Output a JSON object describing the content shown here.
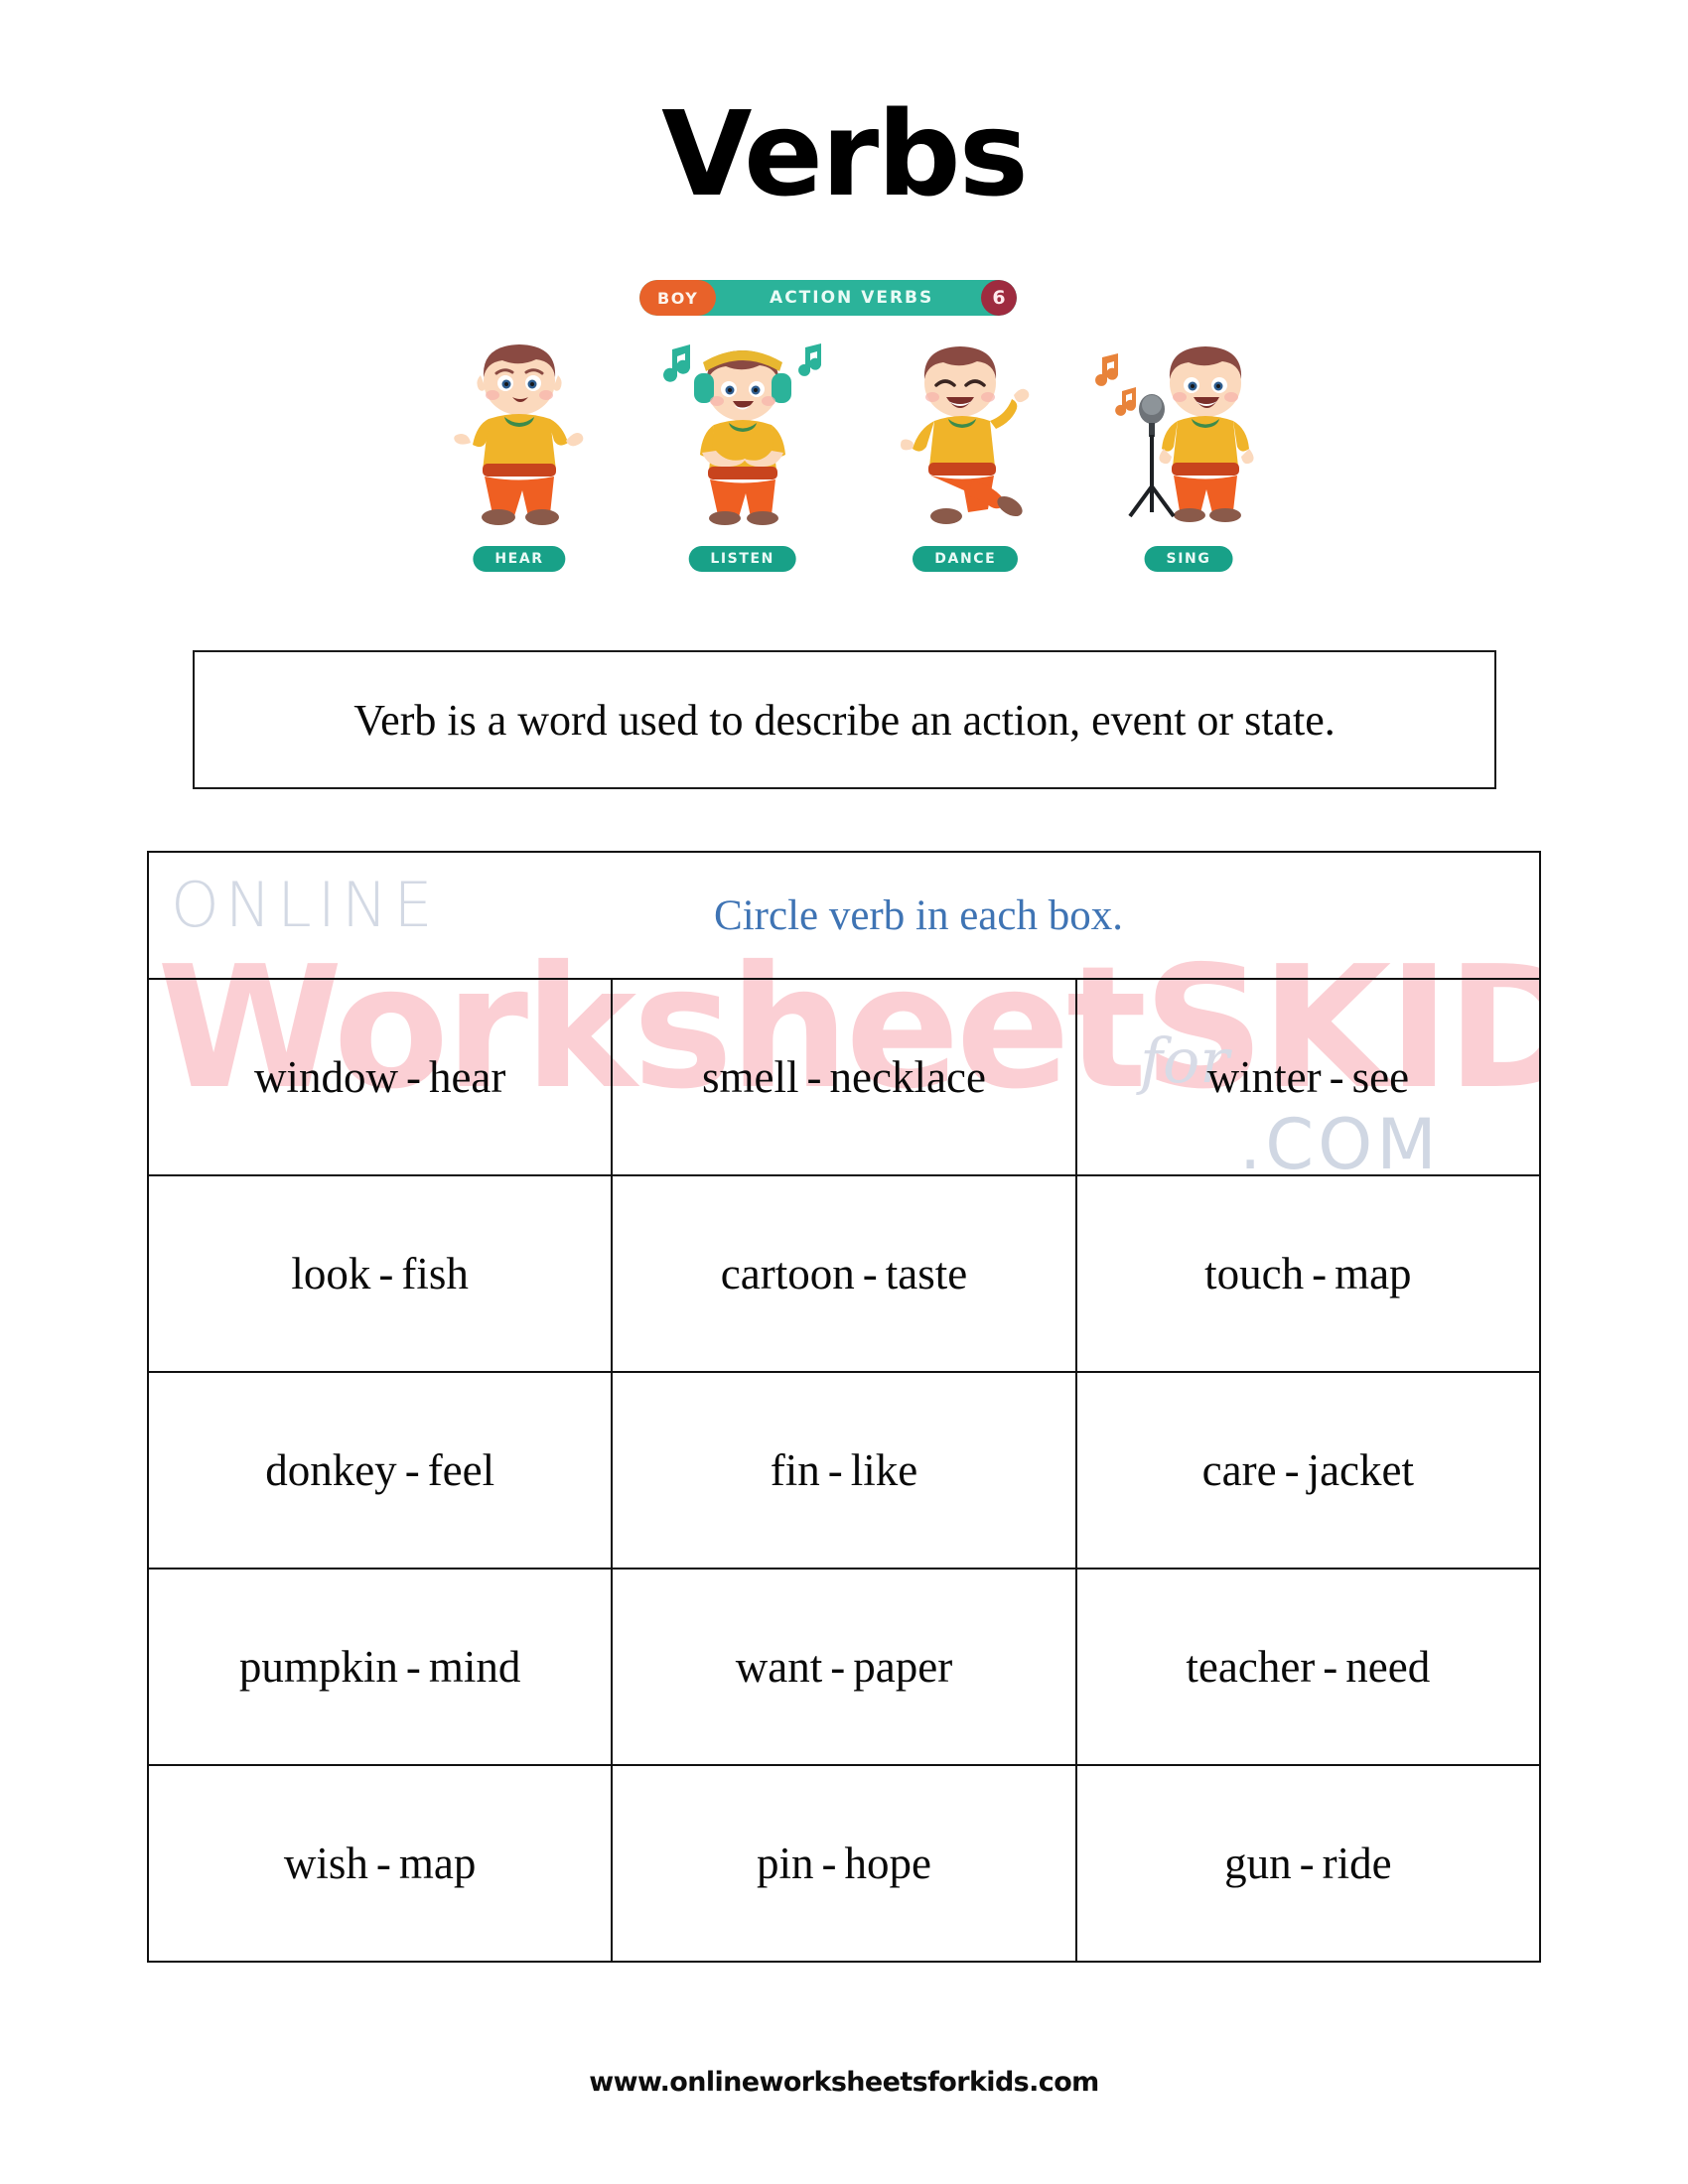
{
  "page": {
    "title": "Verbs",
    "footer_url": "www.onlineworksheetsforkids.com"
  },
  "illustration": {
    "banner": {
      "tag": "BOY",
      "label": "ACTION VERBS",
      "number": "6"
    },
    "figures": [
      {
        "label": "HEAR",
        "pose": "boy-hand-to-ear"
      },
      {
        "label": "LISTEN",
        "pose": "boy-with-headphones"
      },
      {
        "label": "DANCE",
        "pose": "boy-dancing"
      },
      {
        "label": "SING",
        "pose": "boy-with-microphone"
      }
    ],
    "colors": {
      "banner_teal": "#2bb39a",
      "banner_orange": "#e8622a",
      "banner_number_red": "#9e2b3f",
      "label_teal": "#18a188",
      "shirt": "#f0b429",
      "pants": "#ef5f22",
      "hair": "#8a4a42",
      "skin": "#fbd9bd",
      "note_teal": "#2bb39a",
      "note_orange": "#e8833a"
    }
  },
  "definition": {
    "text": "Verb is a word used to describe an action, event or state."
  },
  "instruction": {
    "text": "Circle verb in each box."
  },
  "watermark": {
    "online": "ONLINE",
    "worksheets": "WorksheetS",
    "for": "for",
    "kids": "KIDS",
    "com": ".COM",
    "pink": "#fbcfd4",
    "gray": "#ccd3e0"
  },
  "grid": {
    "rows": [
      [
        {
          "word_a": "window",
          "separator": "-",
          "word_b": "hear"
        },
        {
          "word_a": "smell",
          "separator": "-",
          "word_b": "necklace"
        },
        {
          "word_a": "winter",
          "separator": "-",
          "word_b": "see"
        }
      ],
      [
        {
          "word_a": "look",
          "separator": "-",
          "word_b": "fish"
        },
        {
          "word_a": "cartoon",
          "separator": "-",
          "word_b": "taste"
        },
        {
          "word_a": "touch",
          "separator": "-",
          "word_b": "map"
        }
      ],
      [
        {
          "word_a": "donkey",
          "separator": "-",
          "word_b": "feel"
        },
        {
          "word_a": "fin",
          "separator": "-",
          "word_b": "like"
        },
        {
          "word_a": "care",
          "separator": "-",
          "word_b": "jacket"
        }
      ],
      [
        {
          "word_a": "pumpkin",
          "separator": "-",
          "word_b": "mind"
        },
        {
          "word_a": "want",
          "separator": "-",
          "word_b": "paper"
        },
        {
          "word_a": "teacher",
          "separator": "-",
          "word_b": "need"
        }
      ],
      [
        {
          "word_a": "wish",
          "separator": "-",
          "word_b": "map"
        },
        {
          "word_a": "pin",
          "separator": "-",
          "word_b": "hope"
        },
        {
          "word_a": "gun",
          "separator": "-",
          "word_b": "ride"
        }
      ]
    ]
  }
}
